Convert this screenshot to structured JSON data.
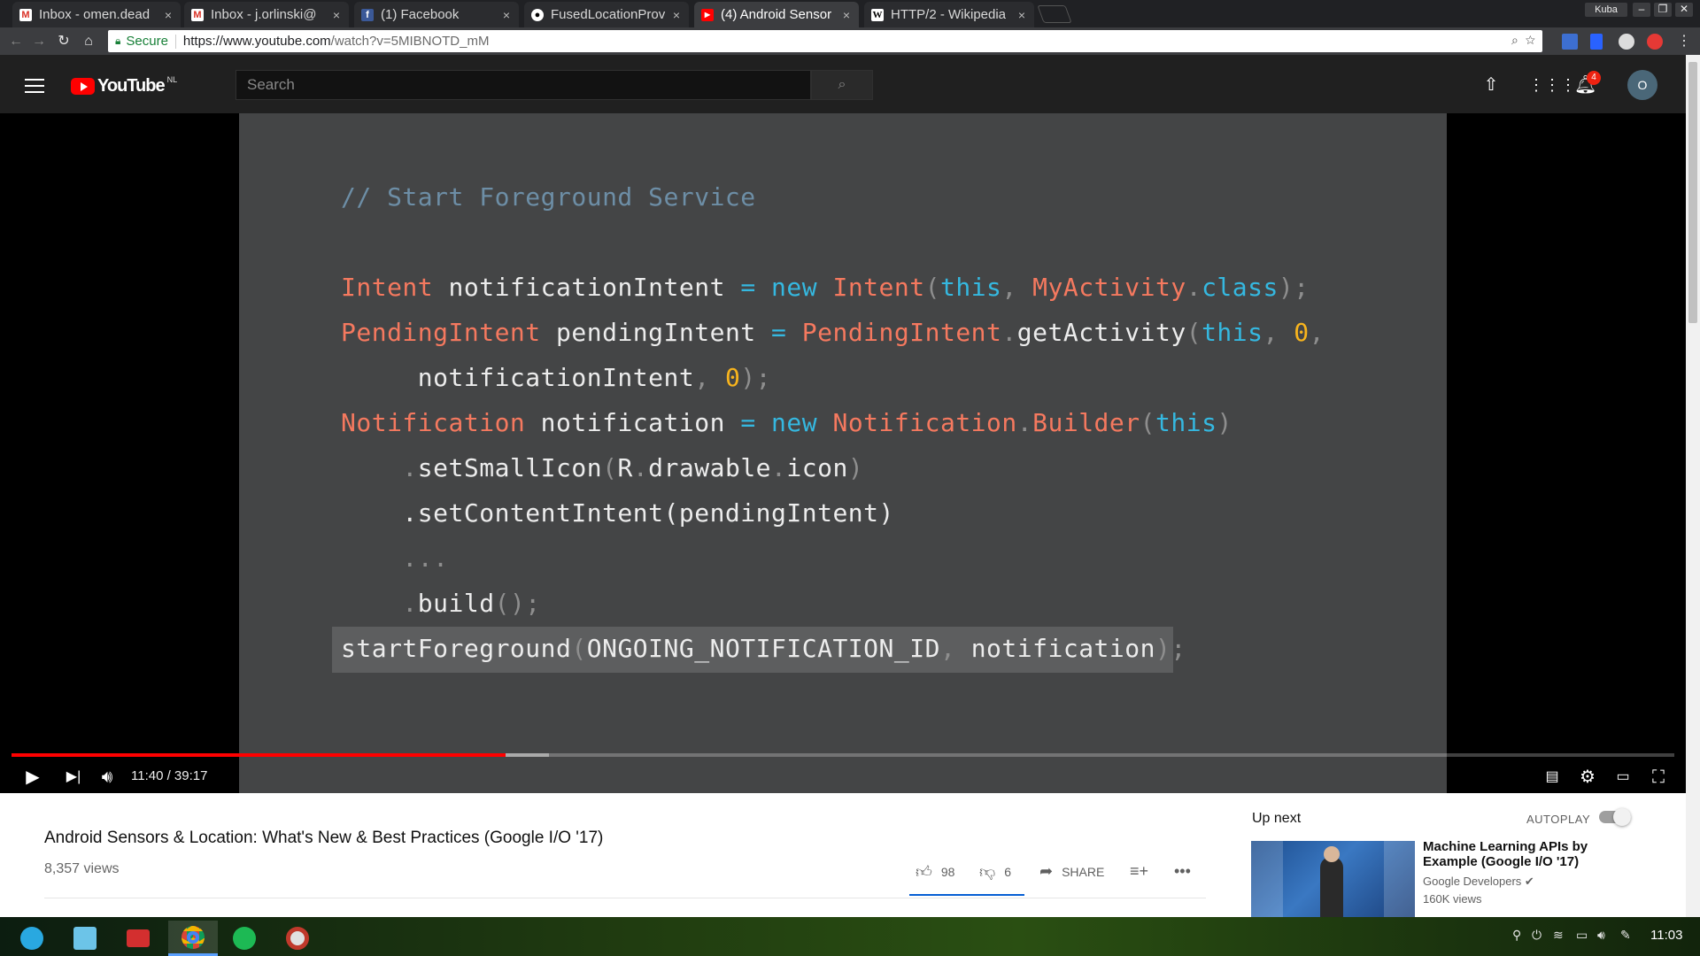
{
  "browser": {
    "tabs": [
      {
        "title": "Inbox - omen.dead",
        "favicon": "gmail-icon",
        "active": false
      },
      {
        "title": "Inbox - j.orlinski@",
        "favicon": "gmail-icon",
        "active": false
      },
      {
        "title": "(1) Facebook",
        "favicon": "facebook-icon",
        "active": false
      },
      {
        "title": "FusedLocationProv",
        "favicon": "github-icon",
        "active": false
      },
      {
        "title": "(4) Android Sensor",
        "favicon": "youtube-icon",
        "active": true
      },
      {
        "title": "HTTP/2 - Wikipedia",
        "favicon": "wikipedia-icon",
        "active": false
      }
    ],
    "tab_close": "×",
    "profile_name": "Kuba",
    "window_buttons": {
      "minimize": "–",
      "restore": "❐",
      "close": "✕"
    },
    "address": {
      "secure_label": "Secure",
      "url_host": "https://www.youtube.com",
      "url_path": "/watch?v=5MIBNOTD_mM"
    }
  },
  "youtube": {
    "logo_word": "YouTube",
    "country": "NL",
    "search_placeholder": "Search",
    "notification_count": "4",
    "avatar_letter": "O"
  },
  "slide": {
    "lines": [
      [
        {
          "t": "// Start Foreground Service",
          "c": "com"
        }
      ],
      [
        {
          "t": "Intent",
          "c": "cls"
        },
        {
          "t": " notificationIntent ",
          "c": "txt"
        },
        {
          "t": "=",
          "c": "kw"
        },
        {
          "t": " ",
          "c": "txt"
        },
        {
          "t": "new",
          "c": "kw"
        },
        {
          "t": " ",
          "c": "txt"
        },
        {
          "t": "Intent",
          "c": "cls"
        },
        {
          "t": "(",
          "c": "dim"
        },
        {
          "t": "this",
          "c": "kw"
        },
        {
          "t": ", ",
          "c": "dim"
        },
        {
          "t": "MyActivity",
          "c": "cls"
        },
        {
          "t": ".",
          "c": "dim"
        },
        {
          "t": "class",
          "c": "kw"
        },
        {
          "t": ");",
          "c": "dim"
        }
      ],
      [
        {
          "t": "PendingIntent",
          "c": "cls"
        },
        {
          "t": " pendingIntent ",
          "c": "txt"
        },
        {
          "t": "=",
          "c": "kw"
        },
        {
          "t": " ",
          "c": "txt"
        },
        {
          "t": "PendingIntent",
          "c": "cls"
        },
        {
          "t": ".",
          "c": "dim"
        },
        {
          "t": "getActivity",
          "c": "txt"
        },
        {
          "t": "(",
          "c": "dim"
        },
        {
          "t": "this",
          "c": "kw"
        },
        {
          "t": ", ",
          "c": "dim"
        },
        {
          "t": "0",
          "c": "num"
        },
        {
          "t": ",",
          "c": "dim"
        }
      ],
      [
        {
          "t": "     notificationIntent",
          "c": "txt"
        },
        {
          "t": ", ",
          "c": "dim"
        },
        {
          "t": "0",
          "c": "num"
        },
        {
          "t": ");",
          "c": "dim"
        }
      ],
      [
        {
          "t": "Notification",
          "c": "cls"
        },
        {
          "t": " notification ",
          "c": "txt"
        },
        {
          "t": "=",
          "c": "kw"
        },
        {
          "t": " ",
          "c": "txt"
        },
        {
          "t": "new",
          "c": "kw"
        },
        {
          "t": " ",
          "c": "txt"
        },
        {
          "t": "Notification",
          "c": "cls"
        },
        {
          "t": ".",
          "c": "dim"
        },
        {
          "t": "Builder",
          "c": "cls"
        },
        {
          "t": "(",
          "c": "dim"
        },
        {
          "t": "this",
          "c": "kw"
        },
        {
          "t": ")",
          "c": "dim"
        }
      ],
      [
        {
          "t": "    .",
          "c": "dim"
        },
        {
          "t": "setSmallIcon",
          "c": "txt"
        },
        {
          "t": "(",
          "c": "dim"
        },
        {
          "t": "R",
          "c": "txt"
        },
        {
          "t": ".",
          "c": "dim"
        },
        {
          "t": "drawable",
          "c": "txt"
        },
        {
          "t": ".",
          "c": "dim"
        },
        {
          "t": "icon",
          "c": "txt"
        },
        {
          "t": ")",
          "c": "dim"
        }
      ],
      [
        {
          "t": "    .setContentIntent(pendingIntent)",
          "c": "txt"
        }
      ],
      [
        {
          "t": "    ...",
          "c": "dim"
        }
      ],
      [
        {
          "t": "    .",
          "c": "dim"
        },
        {
          "t": "build",
          "c": "txt"
        },
        {
          "t": "();",
          "c": "dim"
        }
      ],
      [
        {
          "t": "startForeground",
          "c": "txt"
        },
        {
          "t": "(",
          "c": "dim"
        },
        {
          "t": "ONGOING_NOTIFICATION_ID",
          "c": "txt"
        },
        {
          "t": ", ",
          "c": "dim"
        },
        {
          "t": "notification",
          "c": "txt"
        },
        {
          "t": ");",
          "c": "dim"
        }
      ]
    ]
  },
  "player": {
    "time": "11:40 / 39:17",
    "played_fraction": 0.297,
    "buffered_fraction": 0.323
  },
  "video": {
    "title": "Android Sensors & Location: What's New & Best Practices (Google I/O '17)",
    "views": "8,357 views",
    "likes": "98",
    "dislikes": "6",
    "share_label": "SHARE"
  },
  "sidebar": {
    "up_next_label": "Up next",
    "autoplay_label": "AUTOPLAY",
    "autoplay_on": true,
    "next_video": {
      "title": "Machine Learning APIs by Example (Google I/O '17)",
      "channel": "Google Developers",
      "views": "160K views"
    }
  },
  "taskbar": {
    "clock": "11:03",
    "apps": [
      "launcher-icon",
      "file-manager-icon",
      "terminal-icon",
      "chrome-icon",
      "spotify-icon",
      "settings-icon"
    ],
    "active_app": "chrome-icon"
  }
}
